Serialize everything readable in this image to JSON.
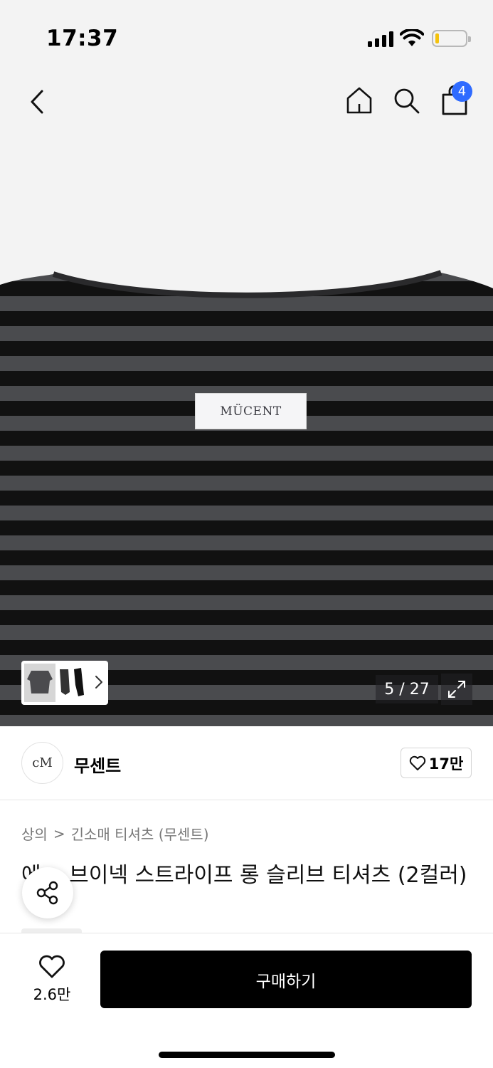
{
  "status_bar": {
    "time": "17:37",
    "battery_level": 0.12
  },
  "nav": {
    "cart_count": "4"
  },
  "hero": {
    "brand_label_text": "MÜCENT",
    "counter": "5 / 27"
  },
  "brand": {
    "logo_text": "cM",
    "name": "무센트",
    "likes": "17만"
  },
  "breadcrumb": {
    "category": "상의",
    "separator": ">",
    "subcategory": "긴소매 티셔츠 (무센트)"
  },
  "product": {
    "title": "에… 브이넥 스트라이프 롱 슬리브 티셔츠 (2컬러)"
  },
  "bottom": {
    "wish_count": "2.6만",
    "buy_label": "구매하기"
  },
  "colors": {
    "accent": "#2f6bff",
    "buy_button": "#000000",
    "stripe_dark": "#111111",
    "stripe_gray": "#4a4b4e"
  }
}
